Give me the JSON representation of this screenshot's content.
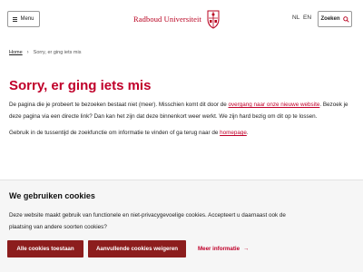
{
  "header": {
    "menu_label": "Menu",
    "logo_text": "Radboud Universiteit",
    "lang_nl": "NL",
    "lang_en": "EN",
    "search_label": "Zoeken",
    "accent_color": "#b8001f"
  },
  "breadcrumb": {
    "home": "Home",
    "current": "Sorry, er ging iets mis"
  },
  "main": {
    "title": "Sorry, er ging iets mis",
    "p1_before": "De pagina die je probeert te bezoeken bestaat niet (meer). Misschien komt dit door de ",
    "p1_link": "overgang naar onze nieuwe website",
    "p1_after": ". Bezoek je deze pagina via een directe link? Dan kan het zijn dat deze binnenkort weer werkt. We zijn hard bezig om dit op te lossen.",
    "p2_before": "Gebruik in de tussentijd de zoekfunctie om informatie te vinden of ga terug naar de ",
    "p2_link": "homepage",
    "p2_after": "."
  },
  "cookies": {
    "title": "We gebruiken cookies",
    "text": "Deze website maakt gebruik van functionele en niet-privacygevoelige cookies. Accepteert u daarnaast ook de plaatsing van andere soorten cookies?",
    "accept_all": "Alle cookies toestaan",
    "necessary": "Aanvullende cookies weigeren",
    "more_info": "Meer informatie",
    "button_color": "#8c1d1d"
  }
}
